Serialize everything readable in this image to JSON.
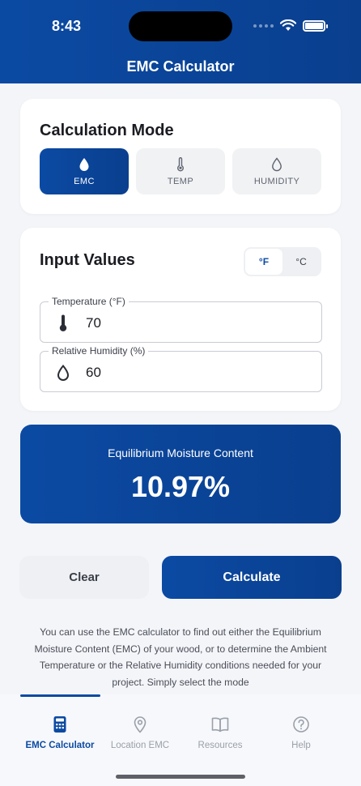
{
  "status": {
    "time": "8:43"
  },
  "header": {
    "title": "EMC Calculator"
  },
  "mode_card": {
    "title": "Calculation Mode",
    "modes": [
      {
        "label": "EMC",
        "icon": "droplet-filled-icon",
        "active": true
      },
      {
        "label": "TEMP",
        "icon": "thermometer-icon",
        "active": false
      },
      {
        "label": "HUMIDITY",
        "icon": "droplet-outline-icon",
        "active": false
      }
    ]
  },
  "input_card": {
    "title": "Input Values",
    "units": [
      {
        "label": "°F",
        "active": true
      },
      {
        "label": "°C",
        "active": false
      }
    ],
    "temperature": {
      "label": "Temperature (°F)",
      "value": "70",
      "icon": "thermometer-icon"
    },
    "humidity": {
      "label": "Relative Humidity (%)",
      "value": "60",
      "icon": "droplet-outline-icon"
    }
  },
  "result": {
    "label": "Equilibrium Moisture Content",
    "value": "10.97%"
  },
  "actions": {
    "clear": "Clear",
    "calculate": "Calculate"
  },
  "description": "You can use the EMC calculator to find out either the Equilibrium Moisture Content (EMC) of your wood, or to determine the Ambient Temperature or the Relative Humidity conditions needed for your project. Simply select the mode",
  "tabs": [
    {
      "label": "EMC Calculator",
      "icon": "calculator-icon",
      "active": true
    },
    {
      "label": "Location EMC",
      "icon": "location-pin-icon",
      "active": false
    },
    {
      "label": "Resources",
      "icon": "book-icon",
      "active": false
    },
    {
      "label": "Help",
      "icon": "help-circle-icon",
      "active": false
    }
  ],
  "colors": {
    "primary": "#0b4aa3",
    "primary_dark": "#0a3f8e",
    "background": "#f4f5f9"
  }
}
